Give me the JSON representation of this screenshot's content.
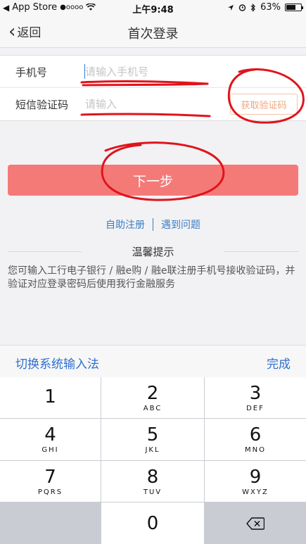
{
  "status_bar": {
    "app_back": "App Store",
    "signal": "●oooo",
    "time": "上午9:48",
    "battery_percent": "63%",
    "battery_level": 0.63
  },
  "nav": {
    "back_label": "返回",
    "title": "首次登录"
  },
  "form": {
    "phone_label": "手机号",
    "phone_placeholder": "请输入手机号",
    "code_label": "短信验证码",
    "code_placeholder": "请输入",
    "get_code_label": "获取验证码"
  },
  "next_label": "下一步",
  "links": {
    "register": "自助注册",
    "problem": "遇到问题"
  },
  "tips": {
    "title": "温馨提示",
    "text": "您可输入工行电子银行 / 融e购 / 融e联注册手机号接收验证码，并验证对应登录密码后使用我行金融服务"
  },
  "keyboard": {
    "switch_label": "切换系统输入法",
    "done_label": "完成",
    "keys": [
      {
        "digit": "1",
        "letters": ""
      },
      {
        "digit": "2",
        "letters": "ABC"
      },
      {
        "digit": "3",
        "letters": "DEF"
      },
      {
        "digit": "4",
        "letters": "GHI"
      },
      {
        "digit": "5",
        "letters": "JKL"
      },
      {
        "digit": "6",
        "letters": "MNO"
      },
      {
        "digit": "7",
        "letters": "PQRS"
      },
      {
        "digit": "8",
        "letters": "TUV"
      },
      {
        "digit": "9",
        "letters": "WXYZ"
      },
      {
        "digit": "0",
        "letters": ""
      }
    ]
  },
  "colors": {
    "accent_blue": "#2f6fd1",
    "button_red": "#f47a78",
    "code_button_orange": "#f2a57a",
    "annotation_red": "#e0141c"
  }
}
